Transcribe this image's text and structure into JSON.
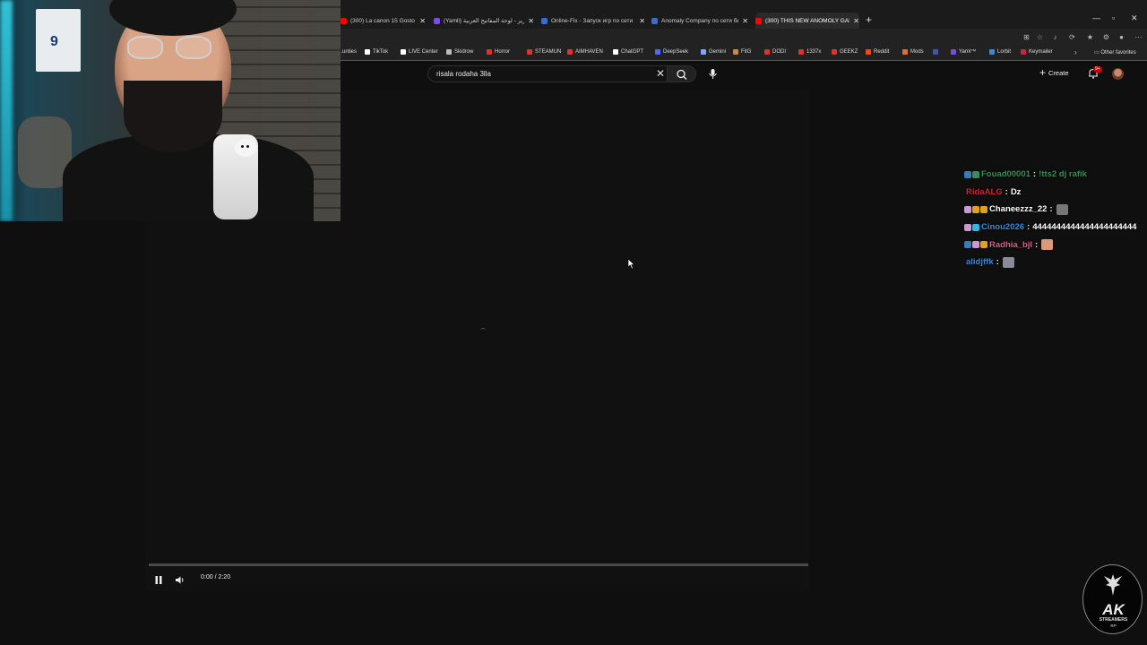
{
  "browser": {
    "tabs": [
      {
        "title": "(300) La canon 15 Gosto Productio",
        "color": "#ff0000",
        "active": false
      },
      {
        "title": "(Yamli) تحرير - لوحة المفاتيح العربية",
        "color": "#7a4de0",
        "active": false
      },
      {
        "title": "Online-Fix - Запуск игр по сети",
        "color": "#3a6ec8",
        "active": false
      },
      {
        "title": "Anomaly Company по сети бесплатно",
        "color": "#3a6ec8",
        "active": false
      },
      {
        "title": "(300) THIS NEW ANOMOLY GAME",
        "color": "#ff0000",
        "active": true
      }
    ],
    "bookmarks": [
      {
        "label": "...unties",
        "color": "#c0a040"
      },
      {
        "label": "TikTok",
        "color": "#ffffff"
      },
      {
        "label": "LIVE Center",
        "color": "#ffffff"
      },
      {
        "label": "Skidrow",
        "color": "#bbbbbb"
      },
      {
        "label": "Horror",
        "color": "#e03030"
      },
      {
        "label": "STEAMUN",
        "color": "#e03030"
      },
      {
        "label": "AIMHAVEN",
        "color": "#e03030"
      },
      {
        "label": "ChatGPT",
        "color": "#ffffff"
      },
      {
        "label": "DeepSeek",
        "color": "#4d6bfe"
      },
      {
        "label": "Gemini",
        "color": "#7aa7ff"
      },
      {
        "label": "FitG",
        "color": "#cc8844"
      },
      {
        "label": "DODI",
        "color": "#e03030"
      },
      {
        "label": "1337x",
        "color": "#e03030"
      },
      {
        "label": "GEEKZ",
        "color": "#e03030"
      },
      {
        "label": "Reddit",
        "color": "#ff4500"
      },
      {
        "label": "Mods",
        "color": "#e07030"
      },
      {
        "label": "",
        "color": "#4455aa"
      },
      {
        "label": "Yaml™",
        "color": "#7a4de0"
      },
      {
        "label": "Lorbit",
        "color": "#3a8ad0"
      },
      {
        "label": "Keymailer",
        "color": "#cc2244"
      }
    ],
    "other_favorites": "Other favorites"
  },
  "youtube": {
    "search_query": "risala rodaha 3lla",
    "create_label": "Create",
    "notification_badge": "9+",
    "player": {
      "time": "0:00 / 2:20",
      "progress": 0.0
    }
  },
  "chat": [
    {
      "user": "Fouad00001",
      "user_color": "#3d8a5a",
      "badges": [
        "#3a7ab8",
        "#3d8a5a"
      ],
      "text": "!tts2 dj rafik",
      "text_color": "#3d8a5a",
      "emote": null
    },
    {
      "user": "RidaALG",
      "user_color": "#d0203a",
      "badges": [],
      "text": "Dz",
      "text_color": "#ffffff",
      "emote": null
    },
    {
      "user": "Chaneezzz_22",
      "user_color": "#ffffff",
      "badges": [
        "#c79ad6",
        "#e0a020",
        "#e0a020"
      ],
      "text": "",
      "text_color": "#ffffff",
      "emote": "#777777"
    },
    {
      "user": "Cinou2026",
      "user_color": "#3a8ad8",
      "badges": [
        "#c79ad6",
        "#30b8e0"
      ],
      "text": "4444444444444444444444",
      "text_color": "#ffffff",
      "emote": null
    },
    {
      "user": "Radhia_bjl",
      "user_color": "#e05a8a",
      "badges": [
        "#3a7ab8",
        "#c79ad6",
        "#e0a020"
      ],
      "text": "",
      "text_color": "#ffffff",
      "emote": "#d99a7a"
    },
    {
      "user": "alidjffk",
      "user_color": "#3a8ad8",
      "badges": [],
      "text": "",
      "text_color": "#ffffff",
      "emote": "#8a8a9a"
    }
  ],
  "logo": {
    "main": "AK",
    "sub": "STREAMERS",
    "sub2": "RP"
  }
}
